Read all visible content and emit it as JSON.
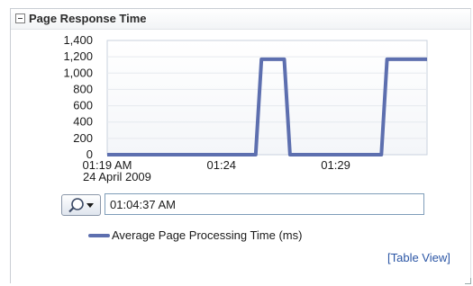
{
  "panel": {
    "title": "Page Response Time",
    "collapse_icon": "collapse-minus-icon"
  },
  "chart_data": {
    "type": "line",
    "title": "",
    "xlabel": "",
    "ylabel": "",
    "ylim": [
      0,
      1400
    ],
    "yticks": [
      "0",
      "200",
      "400",
      "600",
      "800",
      "1,000",
      "1,200",
      "1,400"
    ],
    "xticks": [
      "01:19 AM",
      "01:24",
      "01:29"
    ],
    "date_label": "24 April 2009",
    "grid": true,
    "legend_position": "bottom",
    "series": [
      {
        "name": "Average Page Processing Time (ms)",
        "color": "#5d6faf",
        "points": [
          {
            "x": "01:19",
            "y": 0
          },
          {
            "x": "01:25:30",
            "y": 0
          },
          {
            "x": "01:25:45",
            "y": 1170
          },
          {
            "x": "01:26:45",
            "y": 1170
          },
          {
            "x": "01:27:00",
            "y": 0
          },
          {
            "x": "01:31:00",
            "y": 0
          },
          {
            "x": "01:31:15",
            "y": 1170
          },
          {
            "x": "01:33:00",
            "y": 1170
          }
        ]
      }
    ]
  },
  "controls": {
    "search_icon": "magnifier-dropdown-icon",
    "time_value": "01:04:37 AM"
  },
  "links": {
    "table_view": "[Table View]"
  }
}
